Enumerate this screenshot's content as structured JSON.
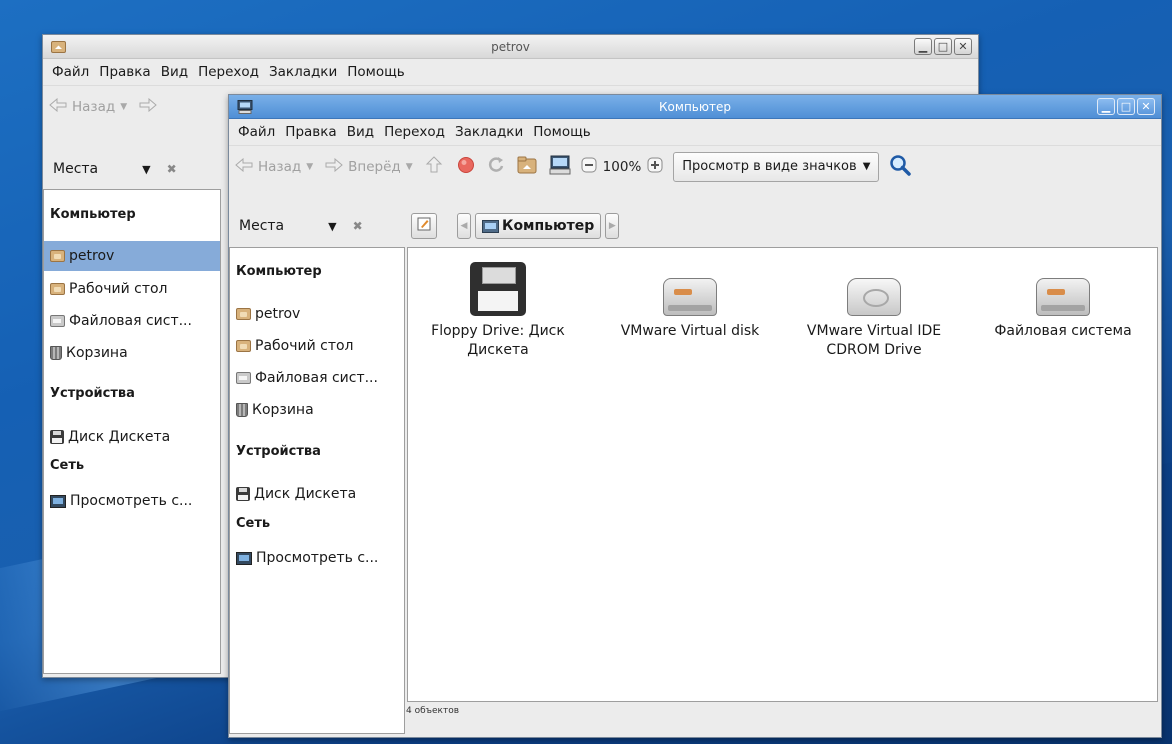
{
  "desktop": {
    "background": "#1560b4"
  },
  "back_window": {
    "title": "petrov",
    "menu": [
      "Файл",
      "Правка",
      "Вид",
      "Переход",
      "Закладки",
      "Помощь"
    ],
    "toolbar": {
      "back_label": "Назад"
    },
    "places_label": "Места",
    "sidebar": {
      "computer_header": "Компьютер",
      "items": [
        "petrov",
        "Рабочий стол",
        "Файловая сист...",
        "Корзина"
      ],
      "devices_header": "Устройства",
      "devices": [
        "Диск Дискета"
      ],
      "network_header": "Сеть",
      "network": [
        "Просмотреть с..."
      ]
    }
  },
  "front_window": {
    "title": "Компьютер",
    "menu": [
      "Файл",
      "Правка",
      "Вид",
      "Переход",
      "Закладки",
      "Помощь"
    ],
    "toolbar": {
      "back_label": "Назад",
      "forward_label": "Вперёд",
      "zoom": "100%",
      "view_mode": "Просмотр в виде значков"
    },
    "places_label": "Места",
    "location": "Компьютер",
    "sidebar": {
      "computer_header": "Компьютер",
      "items": [
        "petrov",
        "Рабочий стол",
        "Файловая сист...",
        "Корзина"
      ],
      "devices_header": "Устройства",
      "devices": [
        "Диск Дискета"
      ],
      "network_header": "Сеть",
      "network": [
        "Просмотреть с..."
      ]
    },
    "files": [
      {
        "name": "Floppy Drive: Диск Дискета",
        "icon": "floppy-drive-icon"
      },
      {
        "name": "VMware Virtual disk",
        "icon": "hard-disk-icon"
      },
      {
        "name": "VMware Virtual IDE CDROM Drive",
        "icon": "cdrom-drive-icon"
      },
      {
        "name": "Файловая система",
        "icon": "hard-disk-icon"
      }
    ],
    "status": "4 объектов"
  }
}
